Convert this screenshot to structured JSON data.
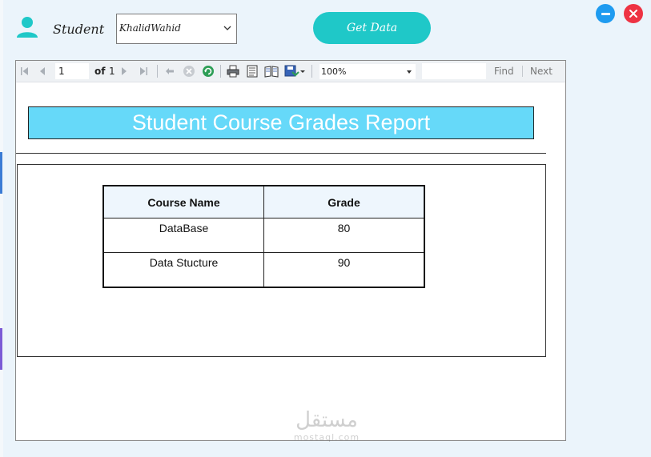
{
  "header": {
    "user_label": "Student",
    "student_select": {
      "value": "KhalidWahid"
    },
    "get_data_label": "Get Data"
  },
  "window_controls": {
    "minimize": "minimize",
    "close": "close"
  },
  "toolbar": {
    "page_current": "1",
    "of_label": "of",
    "page_total": "1",
    "zoom_value": "100%",
    "find_label": "Find",
    "next_label": "Next"
  },
  "report": {
    "title": "Student Course Grades Report",
    "columns": [
      "Course Name",
      "Grade"
    ],
    "rows": [
      {
        "course": "DataBase",
        "grade": "80"
      },
      {
        "course": "Data Stucture",
        "grade": "90"
      }
    ]
  },
  "watermark": {
    "arabic": "مستقل",
    "latin": "mostaql.com"
  },
  "colors": {
    "accent_teal": "#1fc8c8",
    "title_bg": "#66d9f9",
    "minimize": "#1e9bf0",
    "close": "#ee3343",
    "window_bg": "#ebf4fb"
  },
  "icons": [
    "user-icon",
    "first-page-icon",
    "previous-page-icon",
    "next-page-icon",
    "last-page-icon",
    "back-icon",
    "stop-icon",
    "refresh-icon",
    "print-icon",
    "page-layout-icon",
    "page-setup-icon",
    "export-icon",
    "chevron-down-icon"
  ]
}
